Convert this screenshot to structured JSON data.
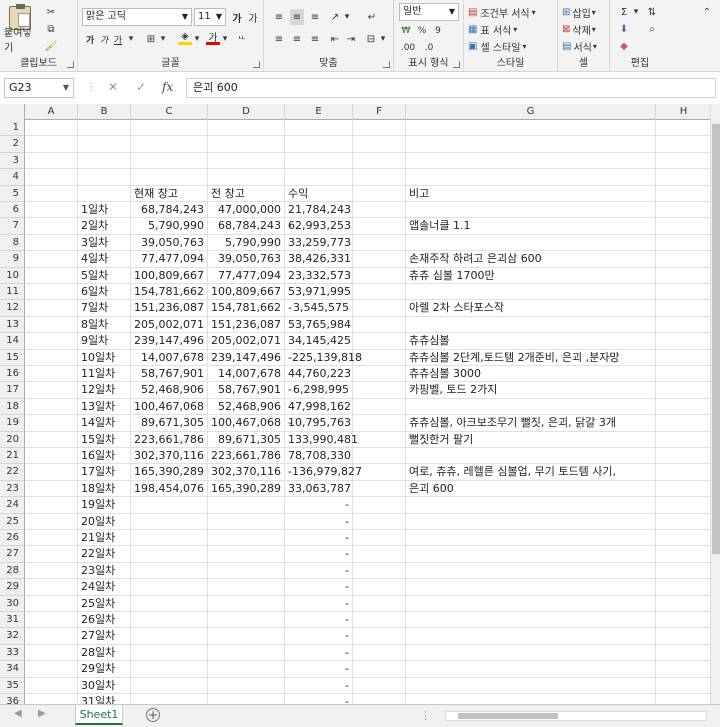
{
  "ribbon": {
    "clipboard": {
      "paste": "붙여넣기",
      "label": "클립보드"
    },
    "font": {
      "name": "맑은 고딕",
      "size": "11",
      "label": "글꼴"
    },
    "align": {
      "label": "맞춤"
    },
    "number": {
      "format": "일반",
      "label": "표시 형식"
    },
    "styles": {
      "cond": "조건부 서식",
      "table": "표 서식",
      "cell": "셀 스타일",
      "label": "스타일"
    },
    "cells": {
      "insert": "삽입",
      "delete": "삭제",
      "format": "서식",
      "label": "셀"
    },
    "editing": {
      "label": "편집"
    }
  },
  "formula_bar": {
    "name_box": "G23",
    "fx": "fx",
    "content": "은괴 600"
  },
  "columns": [
    "A",
    "B",
    "C",
    "D",
    "E",
    "F",
    "G",
    "H"
  ],
  "rows": [
    {
      "n": "1"
    },
    {
      "n": "2"
    },
    {
      "n": "3"
    },
    {
      "n": "4"
    },
    {
      "n": "5",
      "C": "현재 창고",
      "D": "전 창고",
      "E": "수익",
      "G": "비고"
    },
    {
      "n": "6",
      "B": "1일차",
      "C": "68,784,243",
      "D": "47,000,000",
      "E": "21,784,243"
    },
    {
      "n": "7",
      "B": "2일차",
      "C": "5,790,990",
      "D": "68,784,243",
      "E": "62,993,253",
      "neg": true,
      "G": "앱솔너클 1.1"
    },
    {
      "n": "8",
      "B": "3일차",
      "C": "39,050,763",
      "D": "5,790,990",
      "E": "33,259,773"
    },
    {
      "n": "9",
      "B": "4일차",
      "C": "77,477,094",
      "D": "39,050,763",
      "E": "38,426,331",
      "G": "손재주작 하려고 은괴삼 600"
    },
    {
      "n": "10",
      "B": "5일차",
      "C": "100,809,667",
      "D": "77,477,094",
      "E": "23,332,573",
      "G": "츄츄 심볼 1700만"
    },
    {
      "n": "11",
      "B": "6일차",
      "C": "154,781,662",
      "D": "100,809,667",
      "E": "53,971,995"
    },
    {
      "n": "12",
      "B": "7일차",
      "C": "151,236,087",
      "D": "154,781,662",
      "E": "3,545,575",
      "neg": true,
      "G": "아렐 2차 스타포스작"
    },
    {
      "n": "13",
      "B": "8일차",
      "C": "205,002,071",
      "D": "151,236,087",
      "E": "53,765,984"
    },
    {
      "n": "14",
      "B": "9일차",
      "C": "239,147,496",
      "D": "205,002,071",
      "E": "34,145,425",
      "G": "츄츄심볼"
    },
    {
      "n": "15",
      "B": "10일차",
      "C": "14,007,678",
      "D": "239,147,496",
      "E": "-225,139,818",
      "G": "츄츄심볼 2단계,토드템 2개준비, 은괴 ,분자망"
    },
    {
      "n": "16",
      "B": "11일차",
      "C": "58,767,901",
      "D": "14,007,678",
      "E": "44,760,223",
      "G": "츄츄심볼 3000"
    },
    {
      "n": "17",
      "B": "12일차",
      "C": "52,468,906",
      "D": "58,767,901",
      "E": "6,298,995",
      "neg": true,
      "G": "카핑벨, 토드 2가지"
    },
    {
      "n": "18",
      "B": "13일차",
      "C": "100,467,068",
      "D": "52,468,906",
      "E": "47,998,162"
    },
    {
      "n": "19",
      "B": "14일차",
      "C": "89,671,305",
      "D": "100,467,068",
      "E": "10,795,763",
      "neg": true,
      "G": "츄츄심볼, 아크보조무기 뻘짓, 은괴, 닭갈 3개"
    },
    {
      "n": "20",
      "B": "15일차",
      "C": "223,661,786",
      "D": "89,671,305",
      "E": "133,990,481",
      "G": "뻘짓한거 팔기"
    },
    {
      "n": "21",
      "B": "16일차",
      "C": "302,370,116",
      "D": "223,661,786",
      "E": "78,708,330"
    },
    {
      "n": "22",
      "B": "17일차",
      "C": "165,390,289",
      "D": "302,370,116",
      "E": "-136,979,827",
      "G": "여로, 츄츄, 레헬른 심볼업, 무기 토드템 사기,"
    },
    {
      "n": "23",
      "B": "18일차",
      "C": "198,454,076",
      "D": "165,390,289",
      "E": "33,063,787",
      "G": "은괴 600"
    },
    {
      "n": "24",
      "B": "19일차",
      "E": "-"
    },
    {
      "n": "25",
      "B": "20일차",
      "E": "-"
    },
    {
      "n": "26",
      "B": "21일차",
      "E": "-"
    },
    {
      "n": "27",
      "B": "22일차",
      "E": "-"
    },
    {
      "n": "28",
      "B": "23일차",
      "E": "-"
    },
    {
      "n": "29",
      "B": "24일차",
      "E": "-"
    },
    {
      "n": "30",
      "B": "25일차",
      "E": "-"
    },
    {
      "n": "31",
      "B": "26일차",
      "E": "-"
    },
    {
      "n": "32",
      "B": "27일차",
      "E": "-"
    },
    {
      "n": "33",
      "B": "28일차",
      "E": "-"
    },
    {
      "n": "34",
      "B": "29일차",
      "E": "-"
    },
    {
      "n": "35",
      "B": "30일차",
      "E": "-"
    },
    {
      "n": "36",
      "B": "31일차",
      "E": "-"
    }
  ],
  "sheet_tab": "Sheet1",
  "add_sheet": "+",
  "colors": {
    "accent": "#217346"
  }
}
